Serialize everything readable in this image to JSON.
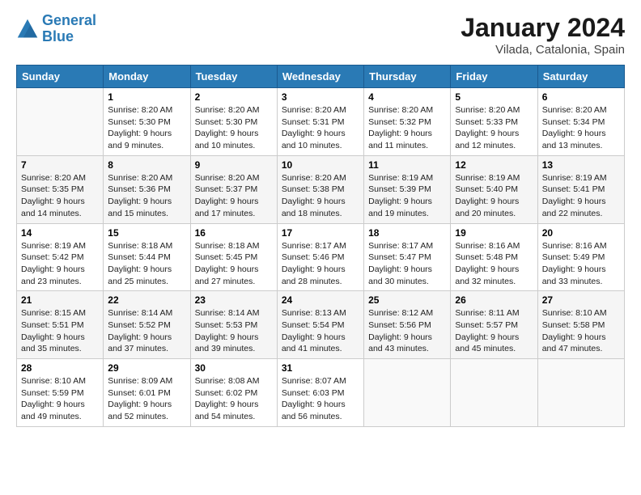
{
  "logo": {
    "line1": "General",
    "line2": "Blue"
  },
  "title": "January 2024",
  "subtitle": "Vilada, Catalonia, Spain",
  "days_header": [
    "Sunday",
    "Monday",
    "Tuesday",
    "Wednesday",
    "Thursday",
    "Friday",
    "Saturday"
  ],
  "weeks": [
    [
      {
        "num": "",
        "info": ""
      },
      {
        "num": "1",
        "info": "Sunrise: 8:20 AM\nSunset: 5:30 PM\nDaylight: 9 hours\nand 9 minutes."
      },
      {
        "num": "2",
        "info": "Sunrise: 8:20 AM\nSunset: 5:30 PM\nDaylight: 9 hours\nand 10 minutes."
      },
      {
        "num": "3",
        "info": "Sunrise: 8:20 AM\nSunset: 5:31 PM\nDaylight: 9 hours\nand 10 minutes."
      },
      {
        "num": "4",
        "info": "Sunrise: 8:20 AM\nSunset: 5:32 PM\nDaylight: 9 hours\nand 11 minutes."
      },
      {
        "num": "5",
        "info": "Sunrise: 8:20 AM\nSunset: 5:33 PM\nDaylight: 9 hours\nand 12 minutes."
      },
      {
        "num": "6",
        "info": "Sunrise: 8:20 AM\nSunset: 5:34 PM\nDaylight: 9 hours\nand 13 minutes."
      }
    ],
    [
      {
        "num": "7",
        "info": "Sunrise: 8:20 AM\nSunset: 5:35 PM\nDaylight: 9 hours\nand 14 minutes."
      },
      {
        "num": "8",
        "info": "Sunrise: 8:20 AM\nSunset: 5:36 PM\nDaylight: 9 hours\nand 15 minutes."
      },
      {
        "num": "9",
        "info": "Sunrise: 8:20 AM\nSunset: 5:37 PM\nDaylight: 9 hours\nand 17 minutes."
      },
      {
        "num": "10",
        "info": "Sunrise: 8:20 AM\nSunset: 5:38 PM\nDaylight: 9 hours\nand 18 minutes."
      },
      {
        "num": "11",
        "info": "Sunrise: 8:19 AM\nSunset: 5:39 PM\nDaylight: 9 hours\nand 19 minutes."
      },
      {
        "num": "12",
        "info": "Sunrise: 8:19 AM\nSunset: 5:40 PM\nDaylight: 9 hours\nand 20 minutes."
      },
      {
        "num": "13",
        "info": "Sunrise: 8:19 AM\nSunset: 5:41 PM\nDaylight: 9 hours\nand 22 minutes."
      }
    ],
    [
      {
        "num": "14",
        "info": "Sunrise: 8:19 AM\nSunset: 5:42 PM\nDaylight: 9 hours\nand 23 minutes."
      },
      {
        "num": "15",
        "info": "Sunrise: 8:18 AM\nSunset: 5:44 PM\nDaylight: 9 hours\nand 25 minutes."
      },
      {
        "num": "16",
        "info": "Sunrise: 8:18 AM\nSunset: 5:45 PM\nDaylight: 9 hours\nand 27 minutes."
      },
      {
        "num": "17",
        "info": "Sunrise: 8:17 AM\nSunset: 5:46 PM\nDaylight: 9 hours\nand 28 minutes."
      },
      {
        "num": "18",
        "info": "Sunrise: 8:17 AM\nSunset: 5:47 PM\nDaylight: 9 hours\nand 30 minutes."
      },
      {
        "num": "19",
        "info": "Sunrise: 8:16 AM\nSunset: 5:48 PM\nDaylight: 9 hours\nand 32 minutes."
      },
      {
        "num": "20",
        "info": "Sunrise: 8:16 AM\nSunset: 5:49 PM\nDaylight: 9 hours\nand 33 minutes."
      }
    ],
    [
      {
        "num": "21",
        "info": "Sunrise: 8:15 AM\nSunset: 5:51 PM\nDaylight: 9 hours\nand 35 minutes."
      },
      {
        "num": "22",
        "info": "Sunrise: 8:14 AM\nSunset: 5:52 PM\nDaylight: 9 hours\nand 37 minutes."
      },
      {
        "num": "23",
        "info": "Sunrise: 8:14 AM\nSunset: 5:53 PM\nDaylight: 9 hours\nand 39 minutes."
      },
      {
        "num": "24",
        "info": "Sunrise: 8:13 AM\nSunset: 5:54 PM\nDaylight: 9 hours\nand 41 minutes."
      },
      {
        "num": "25",
        "info": "Sunrise: 8:12 AM\nSunset: 5:56 PM\nDaylight: 9 hours\nand 43 minutes."
      },
      {
        "num": "26",
        "info": "Sunrise: 8:11 AM\nSunset: 5:57 PM\nDaylight: 9 hours\nand 45 minutes."
      },
      {
        "num": "27",
        "info": "Sunrise: 8:10 AM\nSunset: 5:58 PM\nDaylight: 9 hours\nand 47 minutes."
      }
    ],
    [
      {
        "num": "28",
        "info": "Sunrise: 8:10 AM\nSunset: 5:59 PM\nDaylight: 9 hours\nand 49 minutes."
      },
      {
        "num": "29",
        "info": "Sunrise: 8:09 AM\nSunset: 6:01 PM\nDaylight: 9 hours\nand 52 minutes."
      },
      {
        "num": "30",
        "info": "Sunrise: 8:08 AM\nSunset: 6:02 PM\nDaylight: 9 hours\nand 54 minutes."
      },
      {
        "num": "31",
        "info": "Sunrise: 8:07 AM\nSunset: 6:03 PM\nDaylight: 9 hours\nand 56 minutes."
      },
      {
        "num": "",
        "info": ""
      },
      {
        "num": "",
        "info": ""
      },
      {
        "num": "",
        "info": ""
      }
    ]
  ]
}
